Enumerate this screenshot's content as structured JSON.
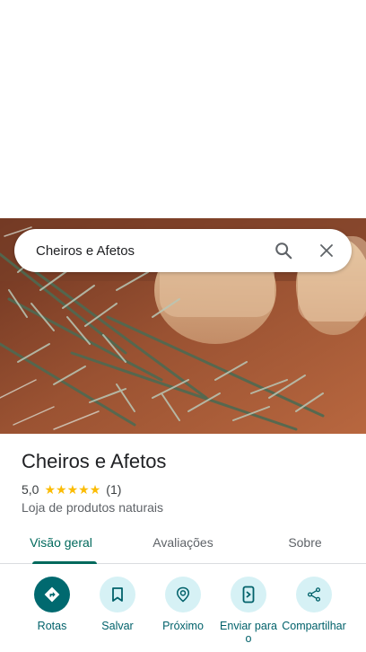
{
  "search": {
    "query": "Cheiros e Afetos"
  },
  "place": {
    "name": "Cheiros e Afetos",
    "rating": "5,0",
    "stars": 5,
    "review_count": "(1)",
    "category": "Loja de produtos naturais"
  },
  "tabs": [
    {
      "label": "Visão geral",
      "active": true
    },
    {
      "label": "Avaliações",
      "active": false
    },
    {
      "label": "Sobre",
      "active": false
    }
  ],
  "actions": [
    {
      "label": "Rotas",
      "icon": "directions-icon"
    },
    {
      "label": "Salvar",
      "icon": "bookmark-icon"
    },
    {
      "label": "Próximo",
      "icon": "nearby-icon"
    },
    {
      "label": "Enviar para o",
      "icon": "send-to-phone-icon"
    },
    {
      "label": "Compartilhar",
      "icon": "share-icon"
    }
  ],
  "colors": {
    "accent": "#00696f",
    "star": "#fbbc04",
    "tab_active": "#00695c"
  }
}
